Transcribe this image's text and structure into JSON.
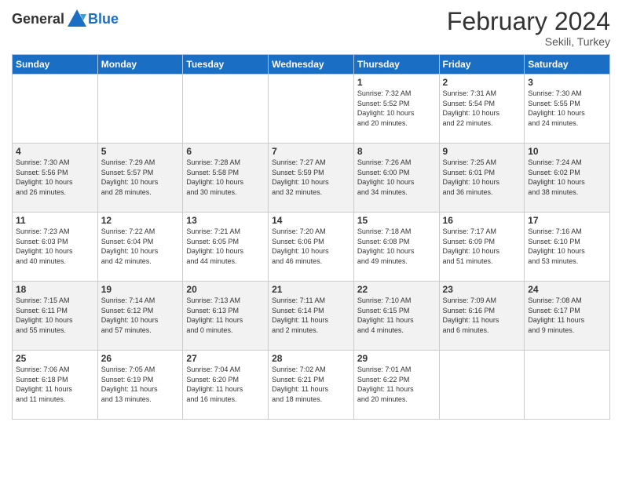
{
  "header": {
    "logo_general": "General",
    "logo_blue": "Blue",
    "title": "February 2024",
    "location": "Sekili, Turkey"
  },
  "days_of_week": [
    "Sunday",
    "Monday",
    "Tuesday",
    "Wednesday",
    "Thursday",
    "Friday",
    "Saturday"
  ],
  "weeks": [
    [
      {
        "day": "",
        "info": ""
      },
      {
        "day": "",
        "info": ""
      },
      {
        "day": "",
        "info": ""
      },
      {
        "day": "",
        "info": ""
      },
      {
        "day": "1",
        "info": "Sunrise: 7:32 AM\nSunset: 5:52 PM\nDaylight: 10 hours\nand 20 minutes."
      },
      {
        "day": "2",
        "info": "Sunrise: 7:31 AM\nSunset: 5:54 PM\nDaylight: 10 hours\nand 22 minutes."
      },
      {
        "day": "3",
        "info": "Sunrise: 7:30 AM\nSunset: 5:55 PM\nDaylight: 10 hours\nand 24 minutes."
      }
    ],
    [
      {
        "day": "4",
        "info": "Sunrise: 7:30 AM\nSunset: 5:56 PM\nDaylight: 10 hours\nand 26 minutes."
      },
      {
        "day": "5",
        "info": "Sunrise: 7:29 AM\nSunset: 5:57 PM\nDaylight: 10 hours\nand 28 minutes."
      },
      {
        "day": "6",
        "info": "Sunrise: 7:28 AM\nSunset: 5:58 PM\nDaylight: 10 hours\nand 30 minutes."
      },
      {
        "day": "7",
        "info": "Sunrise: 7:27 AM\nSunset: 5:59 PM\nDaylight: 10 hours\nand 32 minutes."
      },
      {
        "day": "8",
        "info": "Sunrise: 7:26 AM\nSunset: 6:00 PM\nDaylight: 10 hours\nand 34 minutes."
      },
      {
        "day": "9",
        "info": "Sunrise: 7:25 AM\nSunset: 6:01 PM\nDaylight: 10 hours\nand 36 minutes."
      },
      {
        "day": "10",
        "info": "Sunrise: 7:24 AM\nSunset: 6:02 PM\nDaylight: 10 hours\nand 38 minutes."
      }
    ],
    [
      {
        "day": "11",
        "info": "Sunrise: 7:23 AM\nSunset: 6:03 PM\nDaylight: 10 hours\nand 40 minutes."
      },
      {
        "day": "12",
        "info": "Sunrise: 7:22 AM\nSunset: 6:04 PM\nDaylight: 10 hours\nand 42 minutes."
      },
      {
        "day": "13",
        "info": "Sunrise: 7:21 AM\nSunset: 6:05 PM\nDaylight: 10 hours\nand 44 minutes."
      },
      {
        "day": "14",
        "info": "Sunrise: 7:20 AM\nSunset: 6:06 PM\nDaylight: 10 hours\nand 46 minutes."
      },
      {
        "day": "15",
        "info": "Sunrise: 7:18 AM\nSunset: 6:08 PM\nDaylight: 10 hours\nand 49 minutes."
      },
      {
        "day": "16",
        "info": "Sunrise: 7:17 AM\nSunset: 6:09 PM\nDaylight: 10 hours\nand 51 minutes."
      },
      {
        "day": "17",
        "info": "Sunrise: 7:16 AM\nSunset: 6:10 PM\nDaylight: 10 hours\nand 53 minutes."
      }
    ],
    [
      {
        "day": "18",
        "info": "Sunrise: 7:15 AM\nSunset: 6:11 PM\nDaylight: 10 hours\nand 55 minutes."
      },
      {
        "day": "19",
        "info": "Sunrise: 7:14 AM\nSunset: 6:12 PM\nDaylight: 10 hours\nand 57 minutes."
      },
      {
        "day": "20",
        "info": "Sunrise: 7:13 AM\nSunset: 6:13 PM\nDaylight: 11 hours\nand 0 minutes."
      },
      {
        "day": "21",
        "info": "Sunrise: 7:11 AM\nSunset: 6:14 PM\nDaylight: 11 hours\nand 2 minutes."
      },
      {
        "day": "22",
        "info": "Sunrise: 7:10 AM\nSunset: 6:15 PM\nDaylight: 11 hours\nand 4 minutes."
      },
      {
        "day": "23",
        "info": "Sunrise: 7:09 AM\nSunset: 6:16 PM\nDaylight: 11 hours\nand 6 minutes."
      },
      {
        "day": "24",
        "info": "Sunrise: 7:08 AM\nSunset: 6:17 PM\nDaylight: 11 hours\nand 9 minutes."
      }
    ],
    [
      {
        "day": "25",
        "info": "Sunrise: 7:06 AM\nSunset: 6:18 PM\nDaylight: 11 hours\nand 11 minutes."
      },
      {
        "day": "26",
        "info": "Sunrise: 7:05 AM\nSunset: 6:19 PM\nDaylight: 11 hours\nand 13 minutes."
      },
      {
        "day": "27",
        "info": "Sunrise: 7:04 AM\nSunset: 6:20 PM\nDaylight: 11 hours\nand 16 minutes."
      },
      {
        "day": "28",
        "info": "Sunrise: 7:02 AM\nSunset: 6:21 PM\nDaylight: 11 hours\nand 18 minutes."
      },
      {
        "day": "29",
        "info": "Sunrise: 7:01 AM\nSunset: 6:22 PM\nDaylight: 11 hours\nand 20 minutes."
      },
      {
        "day": "",
        "info": ""
      },
      {
        "day": "",
        "info": ""
      }
    ]
  ]
}
